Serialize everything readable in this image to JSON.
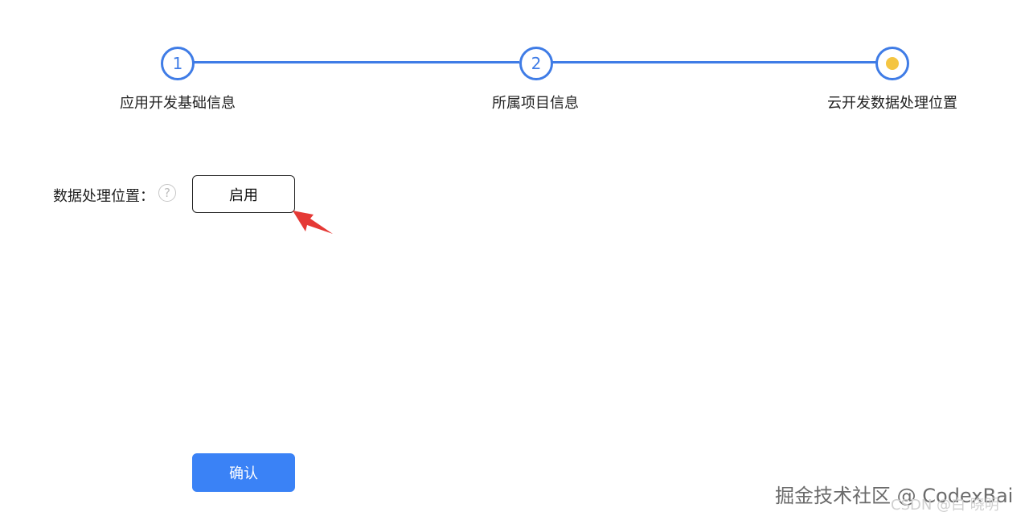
{
  "steps": [
    {
      "number": "1",
      "label": "应用开发基础信息"
    },
    {
      "number": "2",
      "label": "所属项目信息"
    },
    {
      "number": "",
      "label": "云开发数据处理位置"
    }
  ],
  "form": {
    "field_label": "数据处理位置：",
    "help_glyph": "?",
    "enable_label": "启用",
    "confirm_label": "确认"
  },
  "watermark": {
    "main": "掘金技术社区 @ CodexBai",
    "csdn": "CSDN @白 晓明"
  },
  "colors": {
    "accent": "#3f7ce6",
    "current_dot": "#f4c542",
    "confirm": "#3a82f6",
    "arrow": "#e53935"
  },
  "icons": {
    "help": "question-circle-icon",
    "annotation": "red-arrow-icon"
  }
}
